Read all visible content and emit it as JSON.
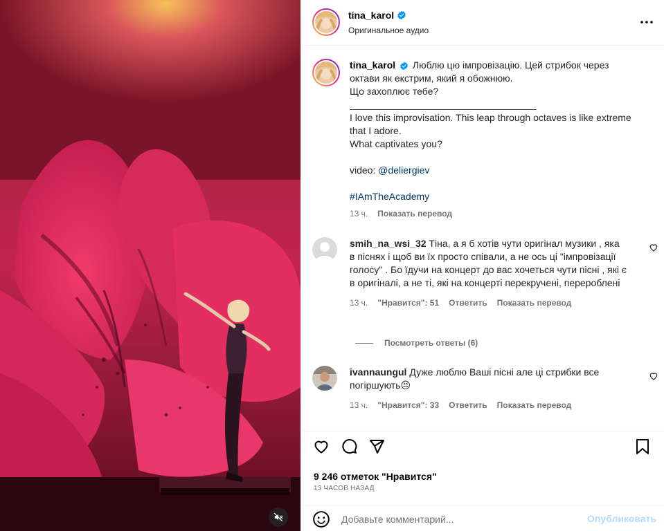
{
  "post": {
    "author": "tina_karol",
    "audio": "Оригинальное аудио",
    "menu_icon": "more-horizontal-icon"
  },
  "caption": {
    "author": "tina_karol",
    "line1": "Люблю цю імпровізацію. Цей стрибок через октави як екстрим, який я обожнюю.",
    "line2": "Що захоплює тебе?",
    "divider": "________________________________________",
    "line3": "I love this improvisation. This leap through octaves is like extreme that I adore.",
    "line4": "What captivates you?",
    "video_prefix": "video: ",
    "video_handle": "@deliergiev",
    "hashtag": "#IAmTheAcademy",
    "time": "13 ч.",
    "translate": "Показать перевод"
  },
  "comments": [
    {
      "user": "smih_na_wsi_32",
      "text": "Тіна, а я б хотів чути оригінал музики , яка в піснях і щоб ви їх просто співали, а не ось ці \"імпровізації голосу\" . Бо їдучи на концерт до вас хочеться чути пісні , які є в оригіналі, а не ті, які на концерті перекручені, перероблені",
      "time": "13 ч.",
      "likes": "\"Нравится\": 51",
      "reply": "Ответить",
      "translate": "Показать перевод",
      "view_replies": "Посмотреть ответы (6)"
    },
    {
      "user": "ivannaungul",
      "text": "Дуже люблю Ваші пісні але ці стрибки все погіршують😣",
      "time": "13 ч.",
      "likes": "\"Нравится\": 33",
      "reply": "Ответить",
      "translate": "Показать перевод"
    }
  ],
  "footer": {
    "likes": "9 246 отметок \"Нравится\"",
    "ago": "13 ЧАСОВ НАЗАД",
    "comment_placeholder": "Добавьте комментарий...",
    "post_label": "Опубликовать"
  },
  "colors": {
    "link": "#00376b",
    "muted": "#737373",
    "post_disabled": "#b3dbff",
    "media_pink": "#e0285a"
  }
}
